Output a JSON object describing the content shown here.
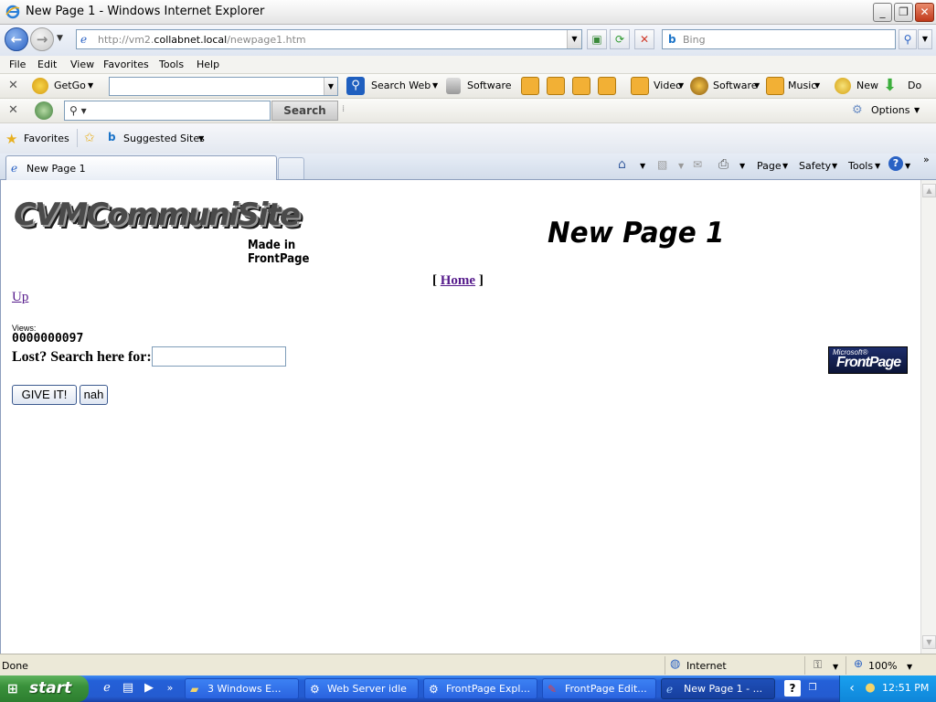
{
  "window": {
    "title": "New Page 1 - Windows Internet Explorer",
    "minimize": "_",
    "restore": "❐",
    "close": "✕"
  },
  "address_bar": {
    "url_prefix": "http://vm2.",
    "url_host": "collabnet.local",
    "url_path": "/newpage1.htm",
    "search_placeholder": "Bing"
  },
  "menu": [
    "File",
    "Edit",
    "View",
    "Favorites",
    "Tools",
    "Help"
  ],
  "toolbar1": {
    "getgo": "GetGo",
    "search_web": "Search Web",
    "software": "Software",
    "video": "Video",
    "software2": "Software",
    "music": "Music",
    "new": "New",
    "do": "Do"
  },
  "toolbar2": {
    "search_button": "Search",
    "options": "Options"
  },
  "favorites_bar": {
    "favorites": "Favorites",
    "suggested": "Suggested Sites"
  },
  "tab": {
    "label": "New Page 1"
  },
  "command_bar": {
    "page": "Page",
    "safety": "Safety",
    "tools": "Tools"
  },
  "page": {
    "logo_main": "CVMCommuniSite",
    "logo_sub": "Made in FrontPage",
    "title": "New Page 1",
    "home_open": "[",
    "home_link": "Home",
    "home_close": "]",
    "up_link": "Up",
    "views_label": "Views:",
    "views_count": "0000000097",
    "search_label": "Lost? Search here for:",
    "submit_button": "GIVE IT!",
    "reset_button": "nah",
    "badge_small": "Microsoft®",
    "badge_big": "FrontPage"
  },
  "status_bar": {
    "status": "Done",
    "zone": "Internet",
    "zoom": "100%"
  },
  "taskbar": {
    "start": "start",
    "items": [
      {
        "label": "3 Windows E..."
      },
      {
        "label": "Web Server idle"
      },
      {
        "label": "FrontPage Expl..."
      },
      {
        "label": "FrontPage Edit..."
      },
      {
        "label": "New Page 1 - ..."
      }
    ],
    "clock": "12:51 PM"
  }
}
